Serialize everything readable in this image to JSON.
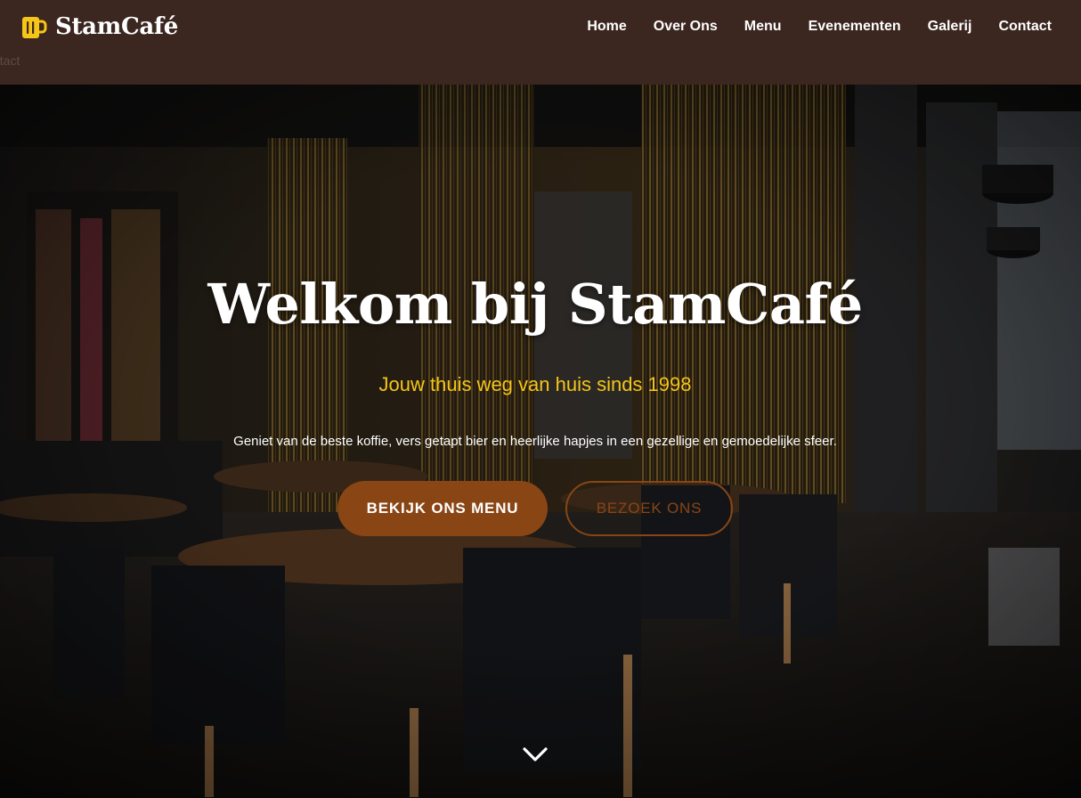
{
  "brand": {
    "name": "StamCafé",
    "icon": "beer-mug-icon",
    "color": "#f5c518"
  },
  "ghost_text": "ntact",
  "nav": {
    "items": [
      {
        "label": "Home"
      },
      {
        "label": "Over Ons"
      },
      {
        "label": "Menu"
      },
      {
        "label": "Evenementen"
      },
      {
        "label": "Galerij"
      },
      {
        "label": "Contact"
      }
    ]
  },
  "hero": {
    "title": "Welkom bij StamCafé",
    "subtitle": "Jouw thuis weg van huis sinds 1998",
    "text": "Geniet van de beste koffie, vers getapt bier en heerlijke hapjes in een gezellige en gemoedelijke sfeer.",
    "primary_button": "BEKIJK ONS MENU",
    "secondary_button": "BEZOEK ONS",
    "scroll_icon": "chevron-down-icon"
  },
  "colors": {
    "nav_bg": "#3b2620",
    "accent": "#8a4515",
    "subtitle": "#f5c518"
  }
}
